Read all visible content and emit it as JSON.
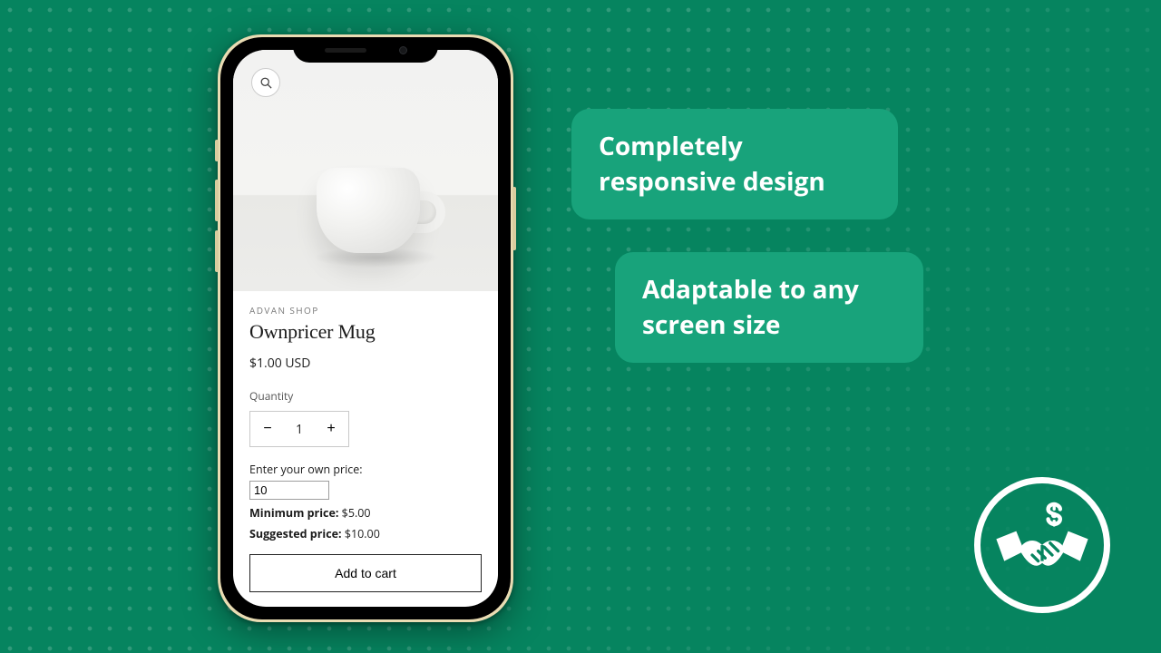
{
  "colors": {
    "background": "#06845f",
    "callout_bg": "#18a37b",
    "gold_rim": "#e9dcb3"
  },
  "callouts": {
    "line1": "Completely responsive design",
    "line2": "Adaptable to any screen size"
  },
  "product": {
    "vendor": "ADVAN SHOP",
    "title": "Ownpricer Mug",
    "price": "$1.00 USD",
    "quantity_label": "Quantity",
    "quantity_value": "1",
    "own_price_label": "Enter your own price:",
    "own_price_value": "10",
    "min_price_label": "Minimum price:",
    "min_price_value": "$5.00",
    "suggested_label": "Suggested price:",
    "suggested_value": "$10.00",
    "add_to_cart": "Add to cart"
  },
  "badge": {
    "name": "handshake-dollar-icon"
  }
}
